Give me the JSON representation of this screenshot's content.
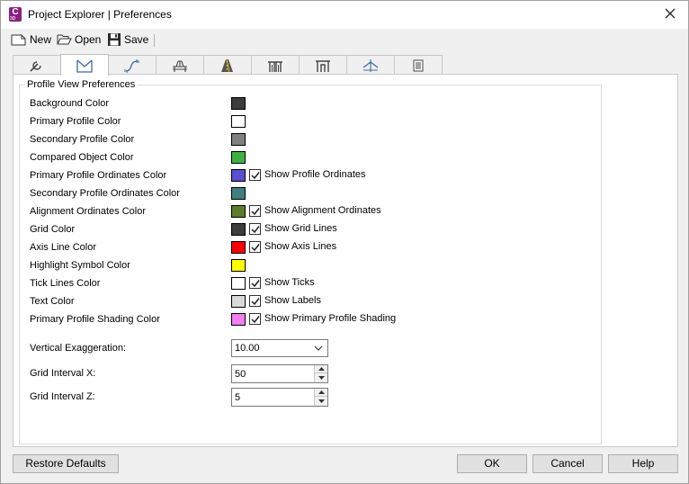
{
  "window": {
    "title": "Project Explorer | Preferences",
    "app_icon_letter": "C",
    "app_icon_sub": "3D"
  },
  "toolbar": {
    "new_label": "New",
    "open_label": "Open",
    "save_label": "Save"
  },
  "tabs": [
    {
      "icon": "wrench-icon",
      "active": false
    },
    {
      "icon": "profile-view-icon",
      "active": true
    },
    {
      "icon": "alignment-curve-icon",
      "active": false
    },
    {
      "icon": "bridge-icon",
      "active": false
    },
    {
      "icon": "road-icon",
      "active": false
    },
    {
      "icon": "pipe-network-icon",
      "active": false
    },
    {
      "icon": "pressure-network-icon",
      "active": false
    },
    {
      "icon": "section-view-icon",
      "active": false
    },
    {
      "icon": "table-icon",
      "active": false
    }
  ],
  "group": {
    "title": "Profile View Preferences",
    "rows": [
      {
        "label": "Background Color",
        "color": "#3c3c3c",
        "checkbox": null
      },
      {
        "label": "Primary Profile Color",
        "color": "#ffffff",
        "checkbox": null
      },
      {
        "label": "Secondary Profile Color",
        "color": "#808080",
        "checkbox": null
      },
      {
        "label": "Compared Object Color",
        "color": "#3cb043",
        "checkbox": null
      },
      {
        "label": "Primary Profile Ordinates Color",
        "color": "#5b4fcf",
        "checkbox": {
          "label": "Show Profile Ordinates",
          "checked": true
        }
      },
      {
        "label": "Secondary Profile Ordinates Color",
        "color": "#3f7f7f",
        "checkbox": null
      },
      {
        "label": "Alignment Ordinates Color",
        "color": "#5e7b2a",
        "checkbox": {
          "label": "Show Alignment Ordinates",
          "checked": true
        }
      },
      {
        "label": "Grid Color",
        "color": "#3c3c3c",
        "checkbox": {
          "label": "Show Grid Lines",
          "checked": true
        }
      },
      {
        "label": "Axis Line Color",
        "color": "#ff0000",
        "checkbox": {
          "label": "Show Axis Lines",
          "checked": true
        }
      },
      {
        "label": "Highlight Symbol Color",
        "color": "#ffff00",
        "checkbox": null
      },
      {
        "label": "Tick Lines Color",
        "color": "#ffffff",
        "checkbox": {
          "label": "Show Ticks",
          "checked": true
        }
      },
      {
        "label": "Text Color",
        "color": "#d9d9d9",
        "checkbox": {
          "label": "Show Labels",
          "checked": true
        }
      },
      {
        "label": "Primary Profile Shading Color",
        "color": "#f07ef0",
        "checkbox": {
          "label": "Show Primary Profile Shading",
          "checked": true
        }
      }
    ],
    "vertical_exaggeration": {
      "label": "Vertical Exaggeration:",
      "value": "10.00"
    },
    "grid_interval_x": {
      "label": "Grid Interval X:",
      "value": "50"
    },
    "grid_interval_z": {
      "label": "Grid Interval Z:",
      "value": "5"
    }
  },
  "footer": {
    "restore_label": "Restore Defaults",
    "ok_label": "OK",
    "cancel_label": "Cancel",
    "help_label": "Help"
  }
}
